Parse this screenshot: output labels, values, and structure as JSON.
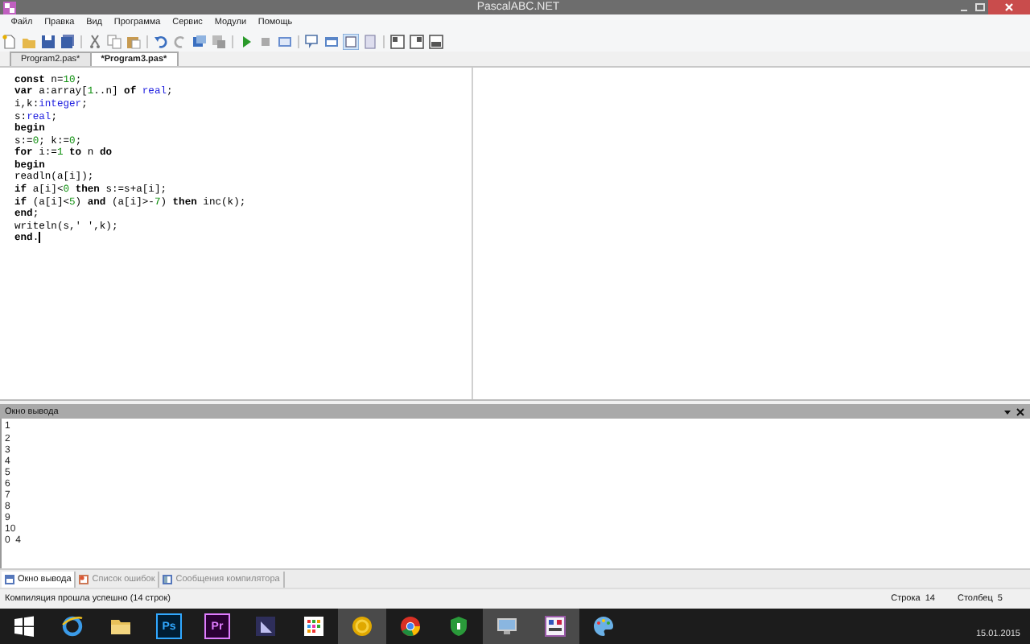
{
  "window": {
    "title": "PascalABC.NET"
  },
  "menu": [
    "Файл",
    "Правка",
    "Вид",
    "Программа",
    "Сервис",
    "Модули",
    "Помощь"
  ],
  "tabs": [
    {
      "label": "Program2.pas*",
      "selected": false
    },
    {
      "label": "*Program3.pas*",
      "selected": true
    }
  ],
  "editor": {
    "lines": [
      [
        {
          "kind": "keyword",
          "text": "const"
        },
        {
          "kind": "plain",
          "text": " n="
        },
        {
          "kind": "number",
          "text": "10"
        },
        {
          "kind": "plain",
          "text": ";"
        }
      ],
      [
        {
          "kind": "keyword",
          "text": "var"
        },
        {
          "kind": "plain",
          "text": " a:array["
        },
        {
          "kind": "number",
          "text": "1"
        },
        {
          "kind": "plain",
          "text": "..n] "
        },
        {
          "kind": "keyword",
          "text": "of "
        },
        {
          "kind": "type",
          "text": "real"
        },
        {
          "kind": "plain",
          "text": ";"
        }
      ],
      [
        {
          "kind": "plain",
          "text": "i,k:"
        },
        {
          "kind": "type",
          "text": "integer"
        },
        {
          "kind": "plain",
          "text": ";"
        }
      ],
      [
        {
          "kind": "plain",
          "text": "s:"
        },
        {
          "kind": "type",
          "text": "real"
        },
        {
          "kind": "plain",
          "text": ";"
        }
      ],
      [
        {
          "kind": "keyword",
          "text": "begin"
        }
      ],
      [
        {
          "kind": "plain",
          "text": "s:="
        },
        {
          "kind": "number",
          "text": "0"
        },
        {
          "kind": "plain",
          "text": "; k:="
        },
        {
          "kind": "number",
          "text": "0"
        },
        {
          "kind": "plain",
          "text": ";"
        }
      ],
      [
        {
          "kind": "keyword",
          "text": "for"
        },
        {
          "kind": "plain",
          "text": " i:="
        },
        {
          "kind": "number",
          "text": "1 "
        },
        {
          "kind": "keyword",
          "text": "to"
        },
        {
          "kind": "plain",
          "text": " n "
        },
        {
          "kind": "keyword",
          "text": "do"
        }
      ],
      [
        {
          "kind": "keyword",
          "text": "begin"
        }
      ],
      [
        {
          "kind": "plain",
          "text": "readln(a[i]);"
        }
      ],
      [
        {
          "kind": "keyword",
          "text": "if"
        },
        {
          "kind": "plain",
          "text": " a[i]<"
        },
        {
          "kind": "number",
          "text": "0 "
        },
        {
          "kind": "keyword",
          "text": "then"
        },
        {
          "kind": "plain",
          "text": " s:=s+a[i];"
        }
      ],
      [
        {
          "kind": "keyword",
          "text": "if"
        },
        {
          "kind": "plain",
          "text": " (a[i]<"
        },
        {
          "kind": "number",
          "text": "5"
        },
        {
          "kind": "plain",
          "text": ") "
        },
        {
          "kind": "keyword",
          "text": "and"
        },
        {
          "kind": "plain",
          "text": " (a[i]>-"
        },
        {
          "kind": "number",
          "text": "7"
        },
        {
          "kind": "plain",
          "text": ") "
        },
        {
          "kind": "keyword",
          "text": "then"
        },
        {
          "kind": "plain",
          "text": " inc(k);"
        }
      ],
      [
        {
          "kind": "keyword",
          "text": "end"
        },
        {
          "kind": "plain",
          "text": ";"
        }
      ],
      [
        {
          "kind": "plain",
          "text": "writeln(s,' ',k);"
        }
      ],
      [
        {
          "kind": "keyword",
          "text": "end"
        },
        {
          "kind": "plain",
          "text": "."
        }
      ]
    ]
  },
  "output": {
    "title": "Окно вывода",
    "lines": [
      "1",
      "2",
      "3",
      "4",
      "5",
      "6",
      "7",
      "8",
      "9",
      "10",
      "0  4"
    ]
  },
  "bottom_tabs": [
    {
      "label": "Окно вывода",
      "selected": true
    },
    {
      "label": "Список ошибок",
      "selected": false
    },
    {
      "label": "Сообщения компилятора",
      "selected": false
    }
  ],
  "status_bar": {
    "message": "Компиляция прошла успешно (14 строк)",
    "line": "Строка  14",
    "column": "Столбец  5"
  },
  "taskbar": {
    "items": [
      {
        "kind": "windows",
        "active": false
      },
      {
        "kind": "browser",
        "active": false
      },
      {
        "kind": "folder",
        "active": false
      },
      {
        "kind": "ps",
        "label": "Ps",
        "active": false
      },
      {
        "kind": "pr",
        "label": "Pr",
        "active": false
      },
      {
        "kind": "app",
        "active": false
      },
      {
        "kind": "tiles",
        "active": false
      },
      {
        "kind": "coin",
        "active": true
      },
      {
        "kind": "chrome",
        "active": false
      },
      {
        "kind": "shield",
        "active": false
      },
      {
        "kind": "monitor",
        "active": true
      },
      {
        "kind": "abc",
        "active": true
      },
      {
        "kind": "palette",
        "active": false
      }
    ],
    "date": "15.01.2015"
  }
}
